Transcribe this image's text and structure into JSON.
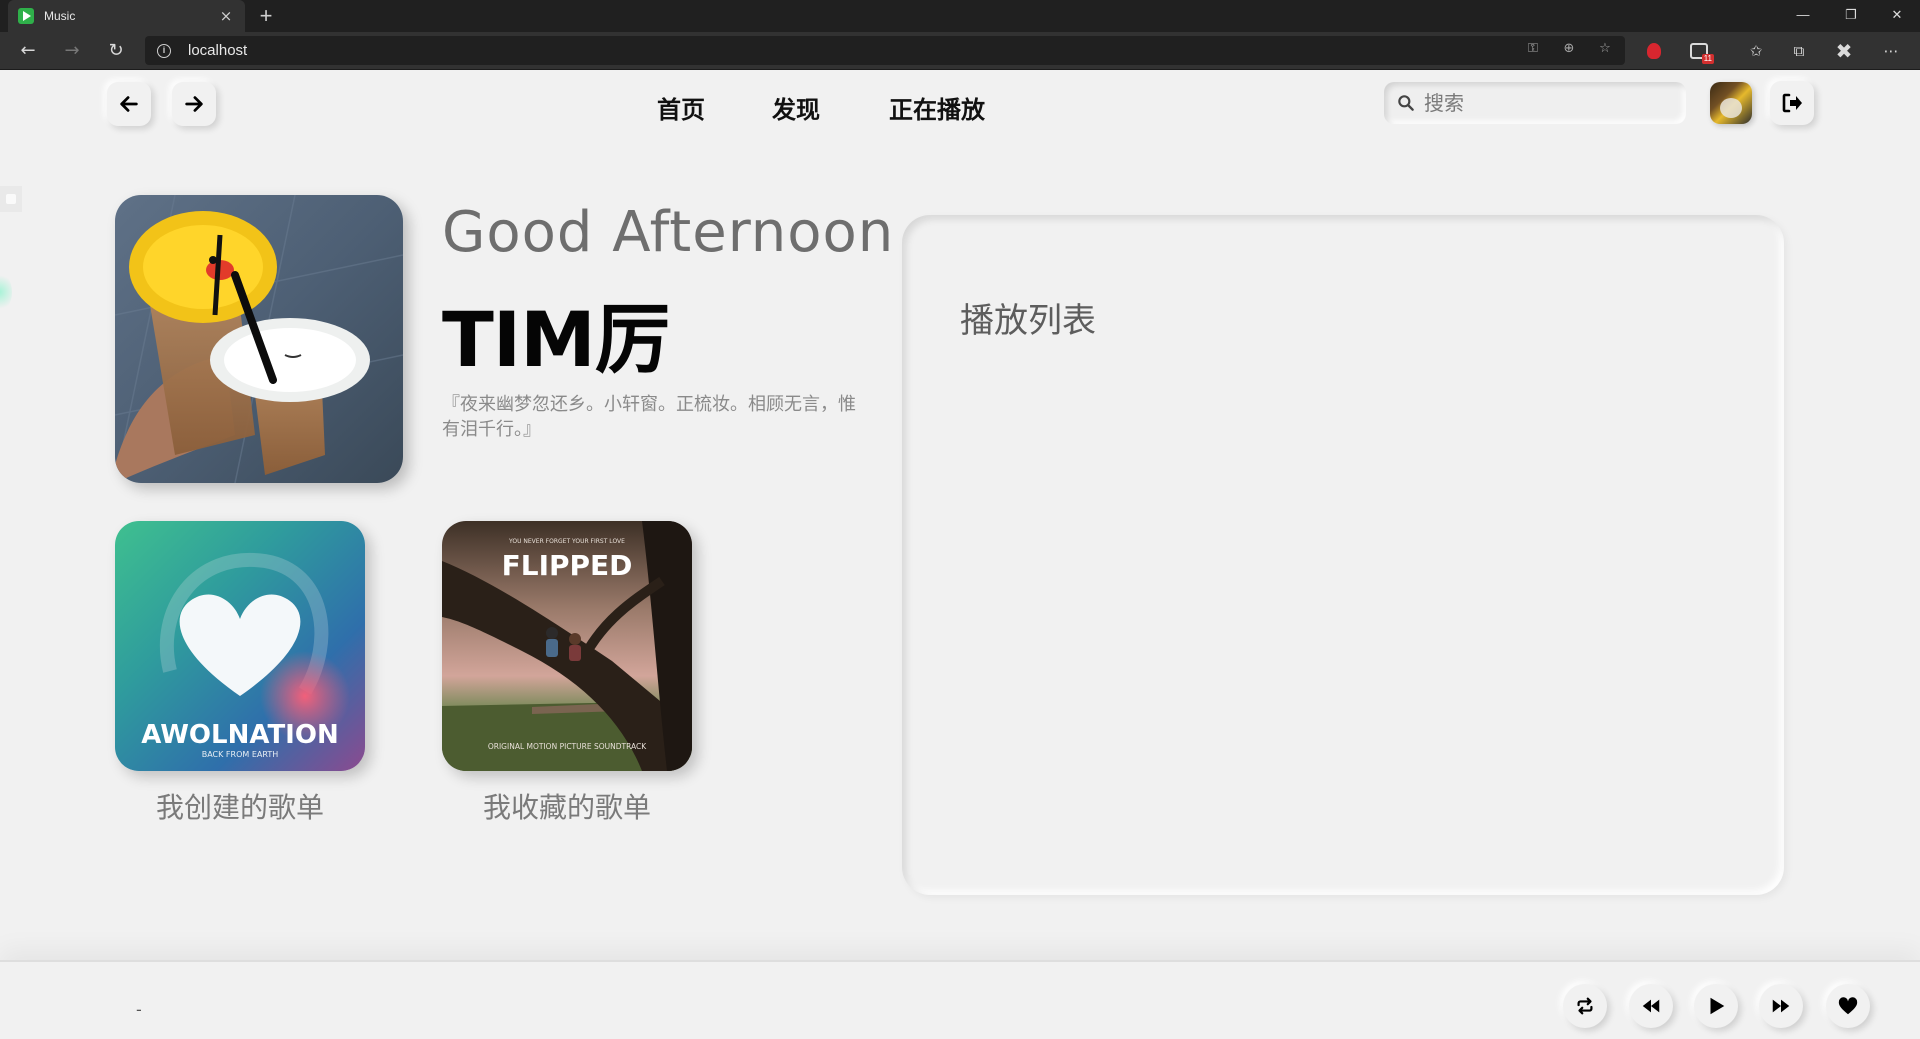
{
  "browser": {
    "tab_title": "Music",
    "tab_close": "×",
    "new_tab": "+",
    "url": "localhost",
    "ext_badge": "11",
    "window_controls": {
      "minimize": "—",
      "restore": "❐",
      "close": "✕"
    },
    "menu": "⋯"
  },
  "header": {
    "back_icon": "arrow-left-icon",
    "forward_icon": "arrow-right-icon",
    "nav": [
      {
        "label": "首页"
      },
      {
        "label": "发现"
      },
      {
        "label": "正在播放"
      }
    ],
    "search": {
      "placeholder": "搜索",
      "value": ""
    },
    "logout_icon": "logout-icon"
  },
  "profile": {
    "greeting": "Good Afternoon",
    "username": "TIM厉",
    "signature": "『夜来幽梦忽还乡。小轩窗。正梳妆。相顾无言，惟有泪千行。』"
  },
  "playlists": [
    {
      "label": "我创建的歌单",
      "cover_text": "AWOLNATION",
      "cover_subtext": "BACK FROM EARTH"
    },
    {
      "label": "我收藏的歌单",
      "cover_text": "FLIPPED",
      "cover_topline": "YOU NEVER FORGET YOUR FIRST LOVE",
      "cover_subtext": "ORIGINAL MOTION PICTURE SOUNDTRACK"
    }
  ],
  "panel": {
    "title": "播放列表"
  },
  "player": {
    "now_playing": "-",
    "controls": [
      "repeat-icon",
      "previous-icon",
      "play-icon",
      "next-icon",
      "heart-icon"
    ]
  },
  "colors": {
    "background": "#f1f1f1",
    "text_primary": "#050505",
    "text_muted": "#7a7a7a"
  }
}
